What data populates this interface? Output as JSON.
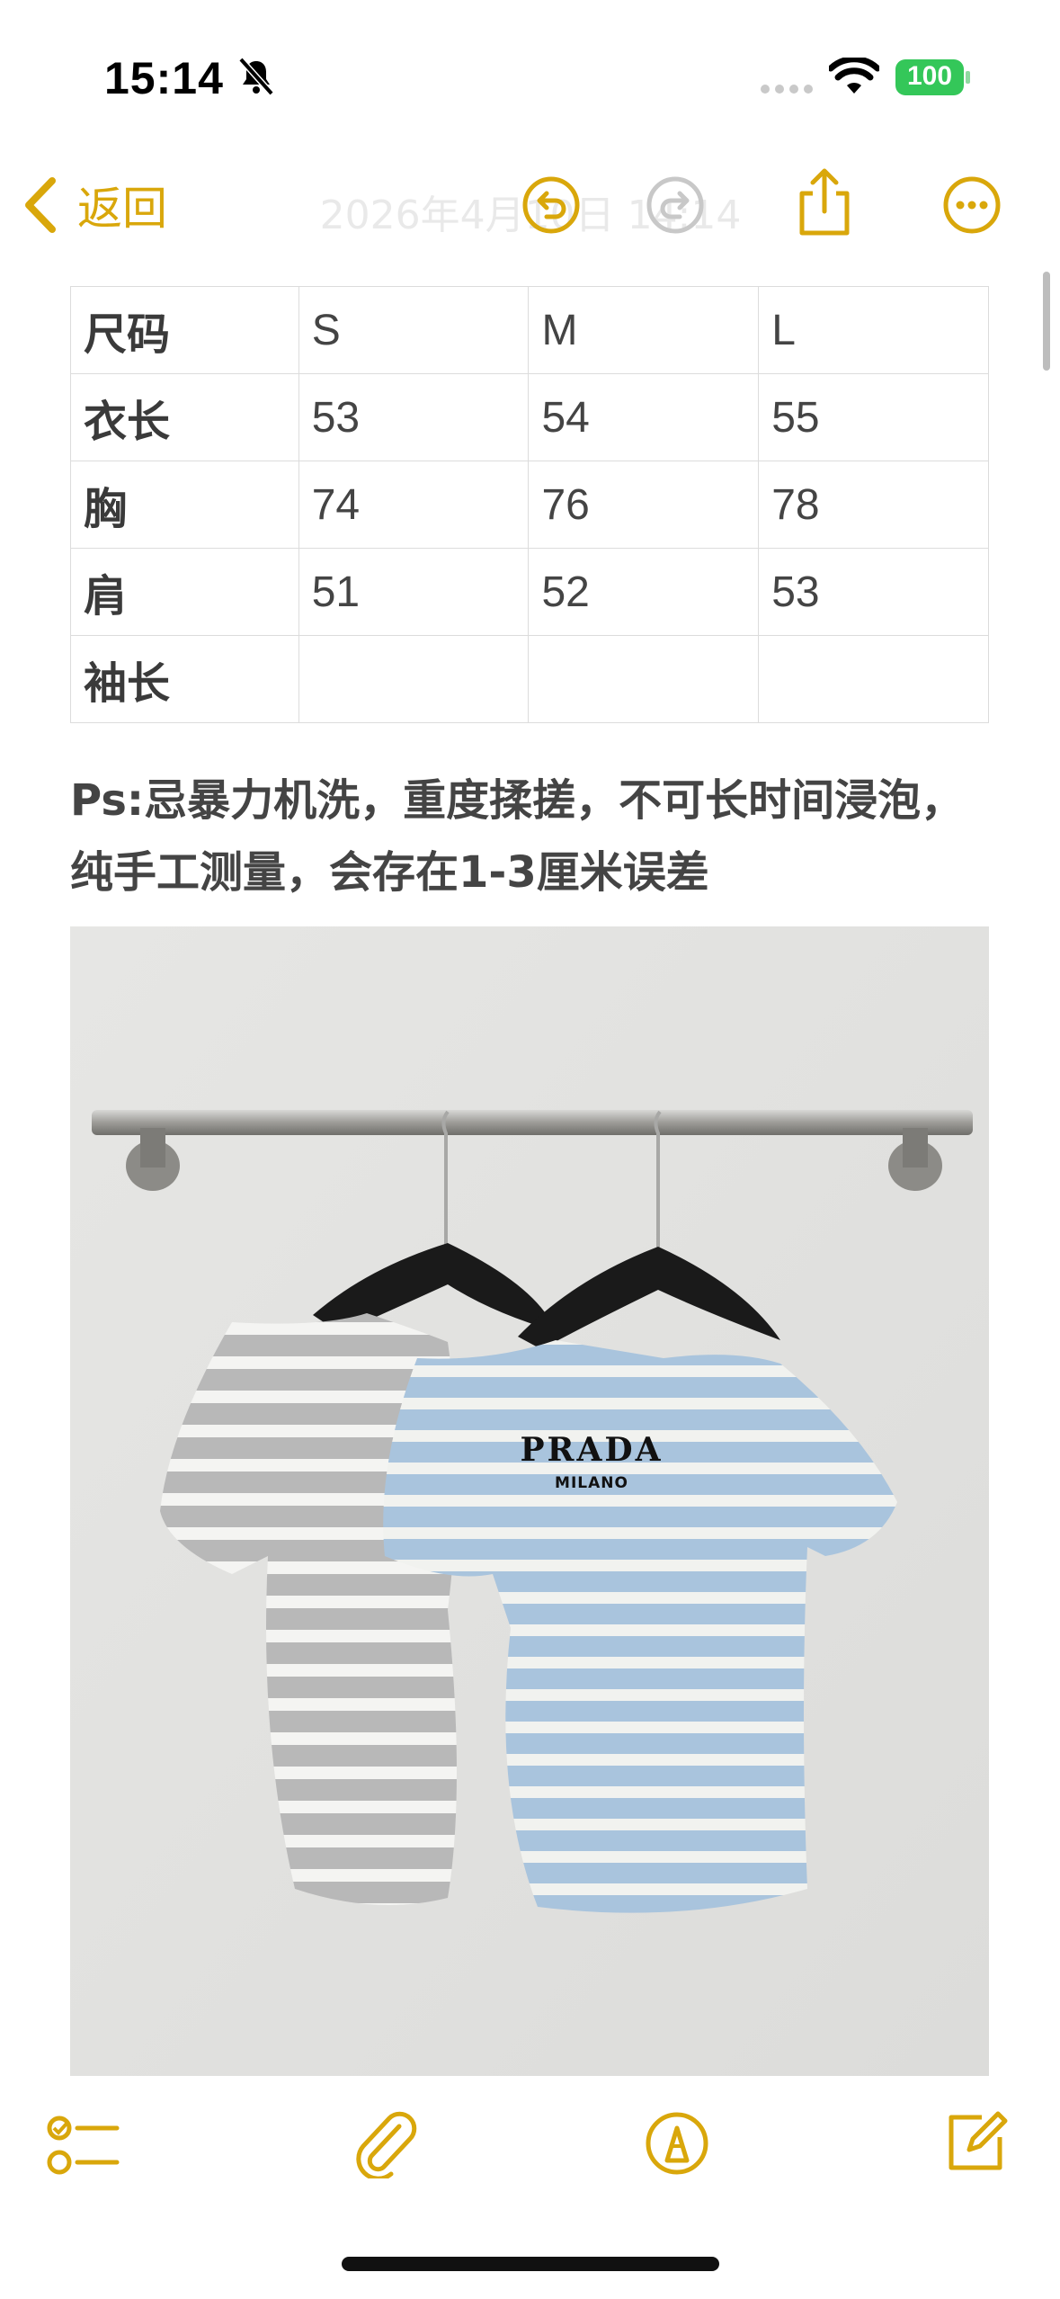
{
  "status": {
    "time": "15:14",
    "battery": "100",
    "accent_battery": "#34c759"
  },
  "nav": {
    "back_label": "返回",
    "title": "2026年4月10日 14:14",
    "accent": "#d9a70b"
  },
  "size_table": {
    "header": [
      "尺码",
      "S",
      "M",
      "L"
    ],
    "rows": [
      [
        "衣长",
        "53",
        "54",
        "55"
      ],
      [
        "胸",
        "74",
        "76",
        "78"
      ],
      [
        "肩",
        "51",
        "52",
        "53"
      ],
      [
        "袖长",
        "",
        "",
        ""
      ]
    ]
  },
  "note": {
    "text": "Ps:忌暴力机洗，重度揉搓，不可长时间浸泡，纯手工测量，会存在1-3厘米误差"
  },
  "photo": {
    "brand": "PRADA",
    "sub": "MILANO"
  },
  "toolbar": {
    "icons": [
      "checklist-icon",
      "paperclip-icon",
      "markup-icon",
      "compose-icon"
    ]
  }
}
